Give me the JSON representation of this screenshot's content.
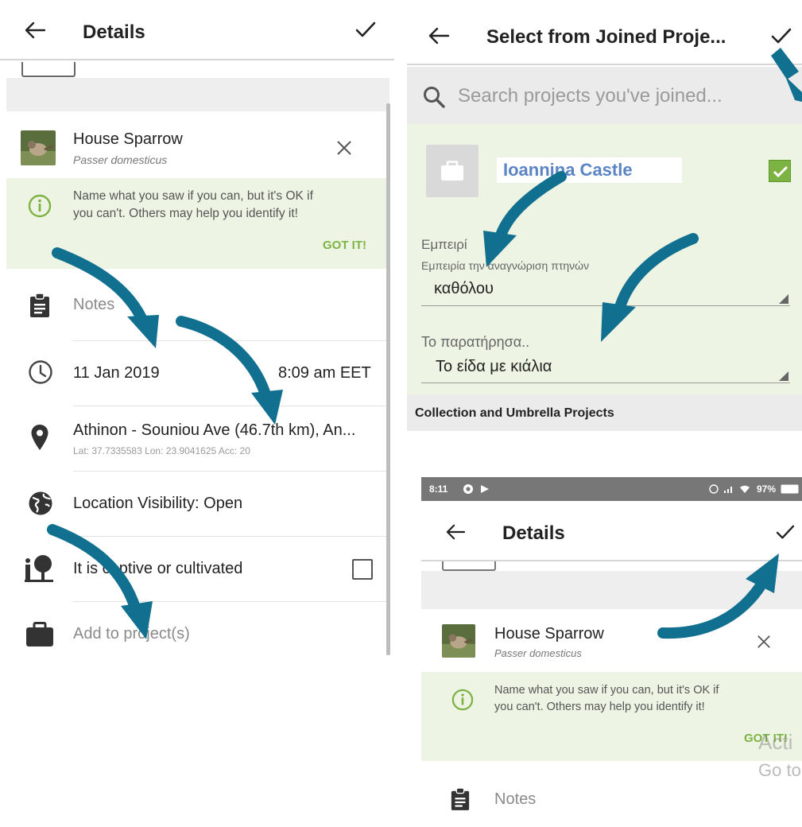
{
  "colors": {
    "accent_green": "#7cb342",
    "hint_bg": "#eef4e3",
    "arrow_teal": "#11708f",
    "band_grey": "#eeeeee"
  },
  "left": {
    "title": "Details",
    "taxon": {
      "name": "House Sparrow",
      "scientific": "Passer domesticus"
    },
    "hint": {
      "line1": "Name what you saw if you can, but it's OK if",
      "line2": "you can't. Others may help you identify it!",
      "action": "GOT IT!"
    },
    "notes_placeholder": "Notes",
    "date": "11 Jan 2019",
    "time": "8:09 am EET",
    "location": {
      "name": "Athinon - Souniou Ave (46.7th km), An...",
      "coords": "Lat: 37.7335583  Lon: 23.9041625  Acc: 20"
    },
    "visibility": "Location Visibility: Open",
    "captive": "It is captive or cultivated",
    "projects": "Add to project(s)"
  },
  "topright": {
    "title": "Select from Joined Proje...",
    "search_placeholder": "Search projects you've joined...",
    "project_name": "Ioannina Castle",
    "field1_label": "Εμπειρί",
    "field1_desc": "Εμπειρία την αναγνώριση πτηνών",
    "field1_value": "καθόλου",
    "field2_label": "Το παρατήρησα..",
    "field2_value": "Το είδα με κιάλια",
    "section_header": "Collection and Umbrella Projects"
  },
  "bottomright": {
    "status": {
      "time": "8:11",
      "battery": "97%"
    },
    "title": "Details",
    "taxon": {
      "name": "House Sparrow",
      "scientific": "Passer domesticus"
    },
    "hint": {
      "line1": "Name what you saw if you can, but it's OK if",
      "line2": "you can't. Others may help you identify it!",
      "action": "GOT IT!"
    },
    "notes_placeholder": "Notes",
    "watermark1": "Acti",
    "watermark2": "Go to"
  },
  "icons": [
    "back-arrow-icon",
    "checkmark-icon",
    "close-icon",
    "info-icon",
    "clipboard-icon",
    "clock-icon",
    "location-pin-icon",
    "globe-icon",
    "tree-person-icon",
    "briefcase-icon",
    "search-icon",
    "dropdown-triangle-icon"
  ]
}
